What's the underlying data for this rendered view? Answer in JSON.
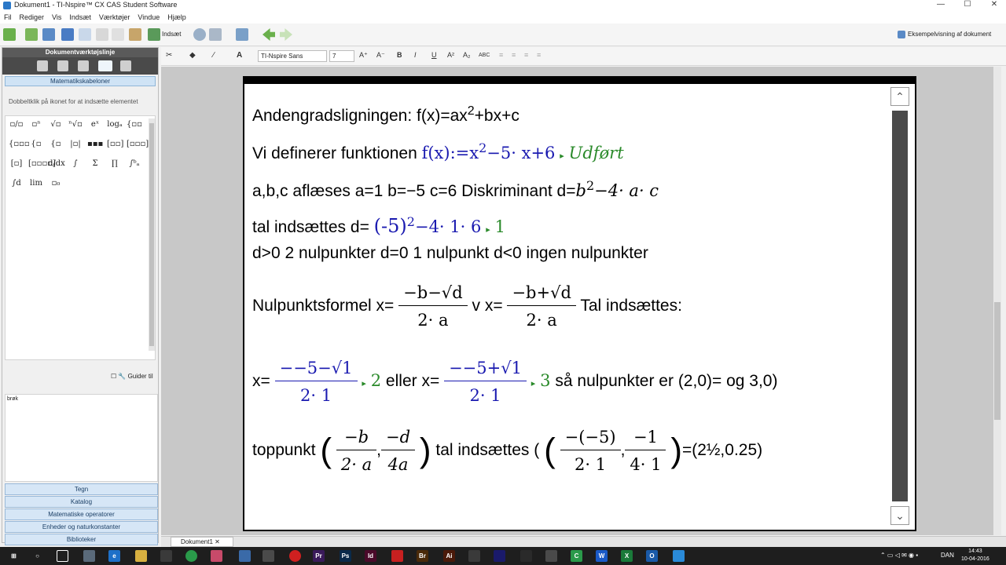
{
  "window": {
    "title": "Dokument1 - TI-Nspire™ CX CAS Student Software",
    "minimize": "—",
    "maximize": "☐",
    "close": "✕"
  },
  "menu": [
    "Fil",
    "Rediger",
    "Vis",
    "Indsæt",
    "Værktøjer",
    "Vindue",
    "Hjælp"
  ],
  "toolbar": {
    "insert_label": "Indsæt",
    "preview_label": "Eksempelvisning af dokument"
  },
  "left_panel": {
    "header": "Dokumentværktøjslinje",
    "sub_tab": "Matematikskabeloner",
    "hint": "Dobbeltklik på ikonet for at indsætte elementet",
    "guide_label": "Guider til",
    "description": "brøk",
    "accordions": [
      "Tegn",
      "Katalog",
      "Matematiske operatorer",
      "Enheder og naturkonstanter",
      "Biblioteker"
    ]
  },
  "templates": [
    "▫/▫",
    "▫ⁿ",
    "√▫",
    "ⁿ√▫",
    "eˣ",
    "logₐ",
    "{▫▫",
    "{▫▫▫",
    "{▫",
    "{▫",
    "|▫|",
    "▪▪▪",
    "[▫▫]",
    "[▫▫▫]",
    "[▫]",
    "[▫▫▫▫]",
    "d/dx",
    "∫",
    "Σ",
    "∏",
    "∫ᵇₐ",
    "∫d",
    "lim",
    "▫₀"
  ],
  "doc_toolbar": {
    "font_name": "TI-Nspire Sans",
    "font_size": "7"
  },
  "document": {
    "line1": {
      "text": "Andengradsligningen:   f(x)=ax",
      "sup": "2",
      "rest": "+bx+c"
    },
    "line2": {
      "prefix": "Vi definerer funktionen ",
      "expr": "f(x):=x",
      "sup": "2",
      "expr_rest": "−5· x+6",
      "arrow": "▸",
      "result": "Udført"
    },
    "line3": {
      "text": "a,b,c aflæses    a=1     b=−5  c=6   Diskriminant  d=",
      "expr": "b",
      "sup": "2",
      "expr_rest": "−4· a· c"
    },
    "line4": {
      "prefix": "tal indsættes    d=  ",
      "expr": "(-5)",
      "sup": "2",
      "expr_rest": "−4· 1· 6",
      "arrow": "▸",
      "result": "1"
    },
    "line5": {
      "text": "d>0  2 nulpunkter   d=0   1 nulpunkt     d<0 ingen nulpunkter"
    },
    "line6": {
      "prefix": "Nulpunktsformel x=",
      "num1": "−b−√d",
      "den1": "2· a",
      "mid": "  v  x=",
      "num2": "−b+√d",
      "den2": "2· a",
      "suffix": "  Tal indsættes:"
    },
    "line7": {
      "prefix": "x=",
      "num1": "−−5−√1",
      "den1": "2· 1",
      "r1": "2",
      "mid": " eller x=",
      "num2": "−−5+√1",
      "den2": "2· 1",
      "r2": "3",
      "arrow": "▸",
      "suffix": "  så nulpunkter er (2,0)= og 3,0)"
    },
    "line8": {
      "prefix": "toppunkt ",
      "n1": "−b",
      "d1": "2· a",
      "n2": "−d",
      "d2": "4a",
      "mid": "  tal indsættes  (",
      "n3": "−(−5)",
      "d3": "2· 1",
      "n4": "−1",
      "d4": "4· 1",
      "suffix": "=(2½,0.25)"
    }
  },
  "bottom": {
    "tab_label": "Dokument1"
  },
  "taskbar": {
    "lang": "DAN",
    "time": "14:43",
    "date": "10-04-2016"
  }
}
